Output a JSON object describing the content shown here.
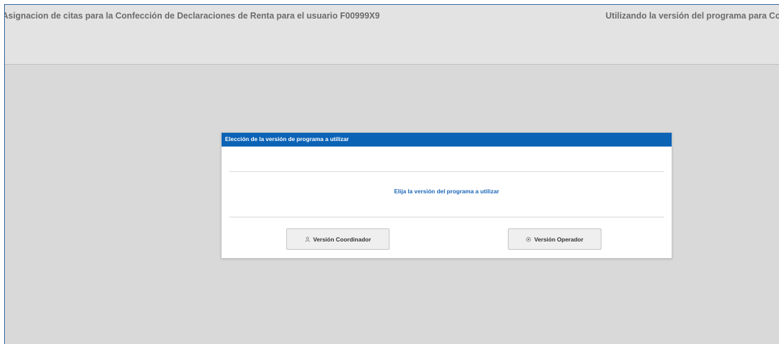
{
  "header": {
    "app_title": "Asignacion de citas para la Confección de Declaraciones de Renta para el usuario F00999X9",
    "version_note": "Utilizando la versión del programa para Coordinador"
  },
  "dialog": {
    "title": "Elección de la versión de programa a utilizar",
    "prompt": "Elija la versión del programa a utilizar",
    "buttons": {
      "coordinator_label": "Versión Coordinador",
      "operator_label": "Versión Operador"
    }
  },
  "icons": {
    "coordinator": "user-icon",
    "operator": "shield-icon"
  },
  "colors": {
    "titlebar": "#0b63b6",
    "prompt_text": "#1a66b8",
    "background": "#d9d9d9"
  }
}
